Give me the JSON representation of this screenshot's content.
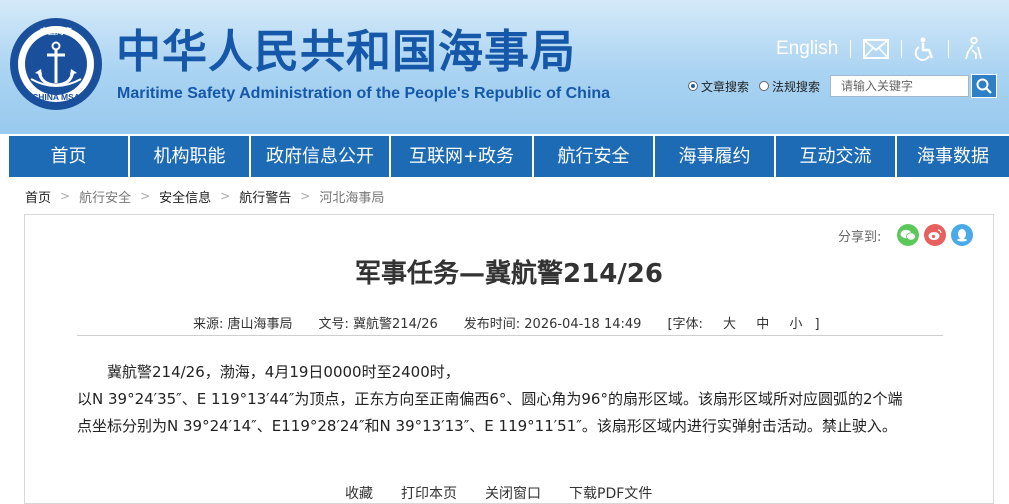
{
  "header": {
    "logo_text": "CHINA MSA",
    "logo_cn": "中国海事",
    "title_cn": "中华人民共和国海事局",
    "title_en": "Maritime Safety Administration of the People's Republic of China",
    "english_link": "English",
    "icons": [
      "mail-icon",
      "accessibility-icon",
      "elder-mode-icon"
    ],
    "search": {
      "radio_text": "文章搜索",
      "radio_regulation": "法规搜索",
      "selected": "文章搜索",
      "placeholder": "请输入关键字"
    }
  },
  "nav": {
    "items": [
      "首页",
      "机构职能",
      "政府信息公开",
      "互联网+政务",
      "航行安全",
      "海事履约",
      "互动交流",
      "海事数据"
    ]
  },
  "breadcrumb": [
    "首页",
    "航行安全",
    "安全信息",
    "航行警告",
    "河北海事局"
  ],
  "share": {
    "label": "分享到:",
    "colors": {
      "wechat": "#5cc85a",
      "weibo": "#e8605b",
      "qq": "#4aa9e9"
    }
  },
  "article": {
    "title": "军事任务—冀航警214/26",
    "source": "来源:  唐山海事局",
    "doc_no": "文号:  冀航警214/26",
    "publish_time": "发布时间:  2026-04-18 14:49",
    "font_label": "[字体:",
    "font_large": "大",
    "font_medium": "中",
    "font_small": "小",
    "font_close": "]",
    "paragraphs": [
      "冀航警214/26，渤海，4月19日0000时至2400时，",
      "以N 39°24′35″、E 119°13′44″为顶点，正东方向至正南偏西6°、圆心角为96°的扇形区域。该扇形区域所对应圆弧的2个端",
      "点坐标分别为N 39°24′14″、E119°28′24″和N 39°13′13″、E 119°11′51″。该扇形区域内进行实弹射击活动。禁止驶入。"
    ],
    "footer_links": [
      "收藏",
      "打印本页",
      "关闭窗口",
      "下载PDF文件"
    ]
  },
  "colors": {
    "brand_blue": "#1557a8",
    "nav_blue": "#1d6bb5"
  }
}
